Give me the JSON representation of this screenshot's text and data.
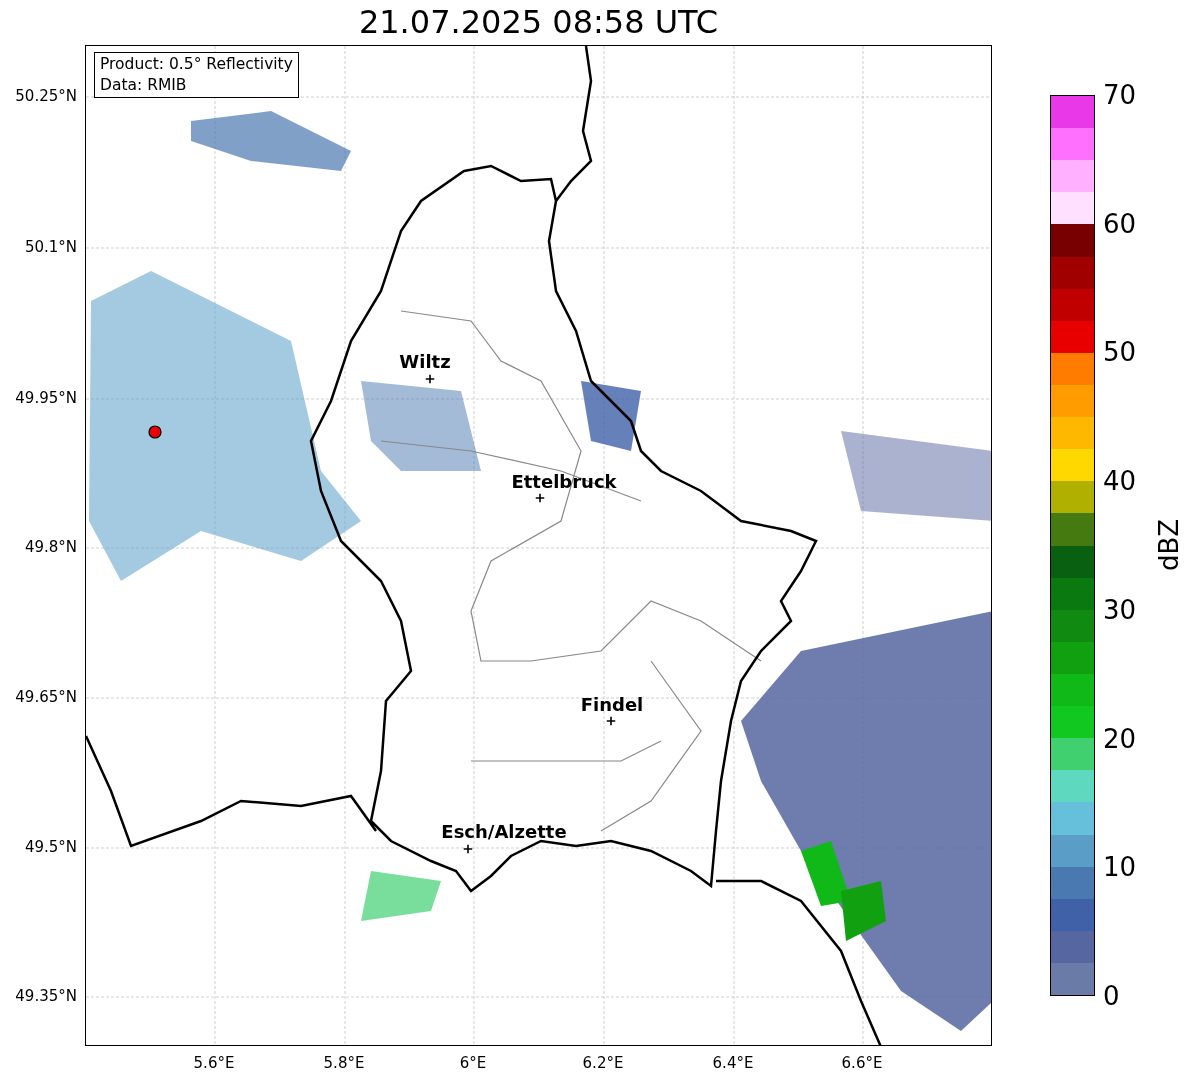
{
  "title": "21.07.2025 08:58 UTC",
  "info_box": [
    "Product: 0.5° Reflectivity",
    "Data: RMIB"
  ],
  "cities": [
    {
      "name": "Wiltz"
    },
    {
      "name": "Ettelbruck"
    },
    {
      "name": "Findel"
    },
    {
      "name": "Esch/Alzette"
    }
  ],
  "yticks": [
    "50.25°N",
    "50.1°N",
    "49.95°N",
    "49.8°N",
    "49.65°N",
    "49.5°N",
    "49.35°N"
  ],
  "xticks": [
    "5.6°E",
    "5.8°E",
    "6°E",
    "6.2°E",
    "6.4°E",
    "6.6°E"
  ],
  "colorbar": {
    "label": "dBZ",
    "ticks": [
      "70",
      "60",
      "50",
      "40",
      "30",
      "20",
      "10",
      "0"
    ],
    "bands": [
      {
        "color": "#e838e8"
      },
      {
        "color": "#ff70ff"
      },
      {
        "color": "#ffb0ff"
      },
      {
        "color": "#ffe0ff"
      },
      {
        "color": "#780000"
      },
      {
        "color": "#a00000"
      },
      {
        "color": "#c00000"
      },
      {
        "color": "#e80000"
      },
      {
        "color": "#ff7c00"
      },
      {
        "color": "#ff9c00"
      },
      {
        "color": "#ffb800"
      },
      {
        "color": "#ffd800"
      },
      {
        "color": "#b0b000"
      },
      {
        "color": "#447a10"
      },
      {
        "color": "#086010"
      },
      {
        "color": "#0a7a10"
      },
      {
        "color": "#108a10"
      },
      {
        "color": "#10a010"
      },
      {
        "color": "#10b818"
      },
      {
        "color": "#10c820"
      },
      {
        "color": "#40d070"
      },
      {
        "color": "#5fd8c0"
      },
      {
        "color": "#66c0dc"
      },
      {
        "color": "#5a9ec8"
      },
      {
        "color": "#4a78b0"
      },
      {
        "color": "#4060a8"
      },
      {
        "color": "#5566a0"
      },
      {
        "color": "#6a7ba8"
      }
    ]
  }
}
